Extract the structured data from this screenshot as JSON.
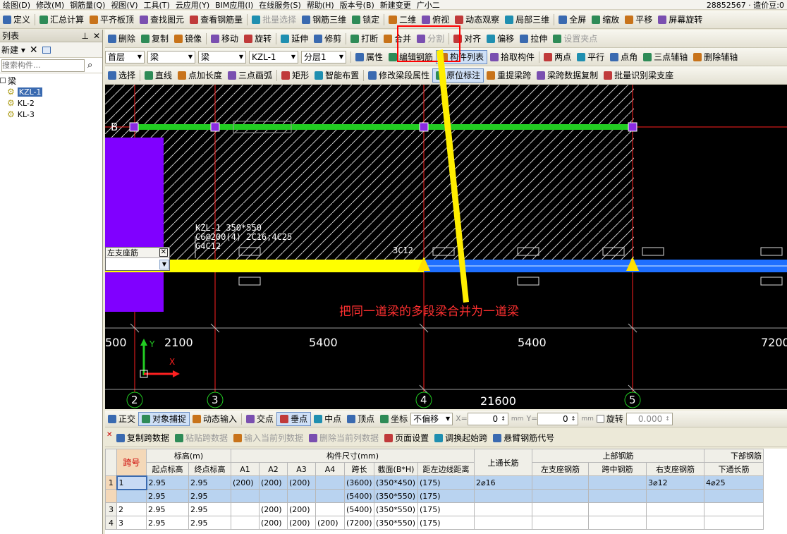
{
  "menu": [
    "绘图(D)",
    "修改(M)",
    "钢筋量(Q)",
    "视图(V)",
    "工具(T)",
    "云应用(Y)",
    "BIM应用(I)",
    "在线服务(S)",
    "帮助(H)",
    "版本号(B)",
    "新建变更",
    "广小二",
    "28852567 · 造价豆:0"
  ],
  "toolbar1": {
    "items": [
      "定义",
      "汇总计算",
      "平齐板顶",
      "查找图元",
      "查看钢筋量",
      "批量选择",
      "钢筋三维",
      "锁定",
      "二维",
      "俯视",
      "动态观察",
      "局部三维",
      "全屏",
      "缩放",
      "平移",
      "屏幕旋转"
    ],
    "disabled": [
      "批量选择"
    ]
  },
  "left": {
    "title": "列表",
    "new_label": "新建",
    "search_placeholder": "搜索构件...",
    "tree_root": "梁",
    "tree_items": [
      "KZL-1",
      "KL-2",
      "KL-3"
    ],
    "selected": "KZL-1"
  },
  "toolbar2": {
    "items": [
      "删除",
      "复制",
      "镜像",
      "移动",
      "旋转",
      "延伸",
      "修剪",
      "打断",
      "合并",
      "分割",
      "对齐",
      "偏移",
      "拉伸",
      "设置夹点"
    ],
    "disabled": [
      "分割",
      "设置夹点"
    ],
    "highlight": "合并"
  },
  "toolbar3": {
    "floor": "首层",
    "type1": "梁",
    "type2": "梁",
    "name": "KZL-1",
    "layer": "分层1",
    "items": [
      "属性",
      "编辑钢筋",
      "构件列表",
      "拾取构件",
      "两点",
      "平行",
      "点角",
      "三点辅轴",
      "删除辅轴"
    ],
    "active": "构件列表"
  },
  "toolbar4": {
    "items": [
      "选择",
      "直线",
      "点加长度",
      "三点画弧",
      "矩形",
      "智能布置",
      "修改梁段属性",
      "原位标注",
      "重提梁跨",
      "梁跨数据复制",
      "批量识别梁支座"
    ],
    "active": "原位标注"
  },
  "canvas": {
    "axis_label_b": "B",
    "beam_annotation": [
      "KZL-1 350*550",
      "C6@200(4) 2C16;4C25",
      "G4C12"
    ],
    "span_label": "3C12",
    "dropdown_label": "左支座筋",
    "note": "把同一道梁的多段梁合并为一道梁",
    "dims": [
      "500",
      "2100",
      "5400",
      "5400",
      "7200"
    ],
    "total_dim": "21600",
    "axis_numbers": [
      "2",
      "3",
      "4",
      "5"
    ],
    "ucs_x": "X",
    "ucs_y": "Y",
    "colors": {
      "beam_green": "#22cc22",
      "beam_yellow": "#ffff00",
      "beam_blue": "#1f6fff",
      "column_purple": "#8000ff",
      "note_red": "#ff3030",
      "arrow_yellow": "#ffee00",
      "highlight_red": "#ff0000"
    }
  },
  "snapbar": {
    "items": [
      "正交",
      "对象捕捉",
      "动态输入",
      "交点",
      "垂点",
      "中点",
      "顶点",
      "坐标"
    ],
    "active": [
      "对象捕捉",
      "垂点"
    ],
    "offset_mode": "不偏移",
    "x_label": "X=",
    "x_value": "0",
    "y_label": "Y=",
    "y_value": "0",
    "unit": "mm",
    "rotate_label": "旋转",
    "rotate_value": "0.000"
  },
  "gridtb": {
    "items": [
      "复制跨数据",
      "粘贴跨数据",
      "输入当前列数据",
      "删除当前列数据",
      "页面设置",
      "调换起始跨",
      "悬臂钢筋代号"
    ],
    "disabled": [
      "粘贴跨数据",
      "输入当前列数据",
      "删除当前列数据"
    ]
  },
  "table": {
    "group_headers": {
      "span": "跨号",
      "elev": "标高(m)",
      "dims": "构件尺寸(mm)",
      "top_long": "上通长筋",
      "top_rebar": "上部钢筋",
      "bottom_rebar": "下部钢筋"
    },
    "sub_headers": [
      "起点标高",
      "终点标高",
      "A1",
      "A2",
      "A3",
      "A4",
      "跨长",
      "截面(B*H)",
      "距左边线距离",
      "左支座钢筋",
      "跨中钢筋",
      "右支座钢筋",
      "下通长筋"
    ],
    "rows": [
      {
        "row": "1",
        "span": "1",
        "start": "2.95",
        "end": "2.95",
        "a1": "(200)",
        "a2": "(200)",
        "a3": "(200)",
        "a4": "",
        "len": "(3600)",
        "sec": "(350*450)",
        "dist": "(175)",
        "top_long": "2⌀16",
        "left": "",
        "mid": "",
        "right": "3⌀12",
        "bot": "4⌀25"
      },
      {
        "row": "",
        "span": "",
        "start": "2.95",
        "end": "2.95",
        "a1": "",
        "a2": "",
        "a3": "",
        "a4": "",
        "len": "(5400)",
        "sec": "(350*550)",
        "dist": "(175)",
        "top_long": "",
        "left": "",
        "mid": "",
        "right": "",
        "bot": ""
      },
      {
        "row": "3",
        "span": "2",
        "start": "2.95",
        "end": "2.95",
        "a1": "",
        "a2": "(200)",
        "a3": "(200)",
        "a4": "",
        "len": "(5400)",
        "sec": "(350*550)",
        "dist": "(175)",
        "top_long": "",
        "left": "",
        "mid": "",
        "right": "",
        "bot": ""
      },
      {
        "row": "4",
        "span": "3",
        "start": "2.95",
        "end": "2.95",
        "a1": "",
        "a2": "(200)",
        "a3": "(200)",
        "a4": "(200)",
        "len": "(7200)",
        "sec": "(350*550)",
        "dist": "(175)",
        "top_long": "",
        "left": "",
        "mid": "",
        "right": "",
        "bot": ""
      }
    ]
  }
}
